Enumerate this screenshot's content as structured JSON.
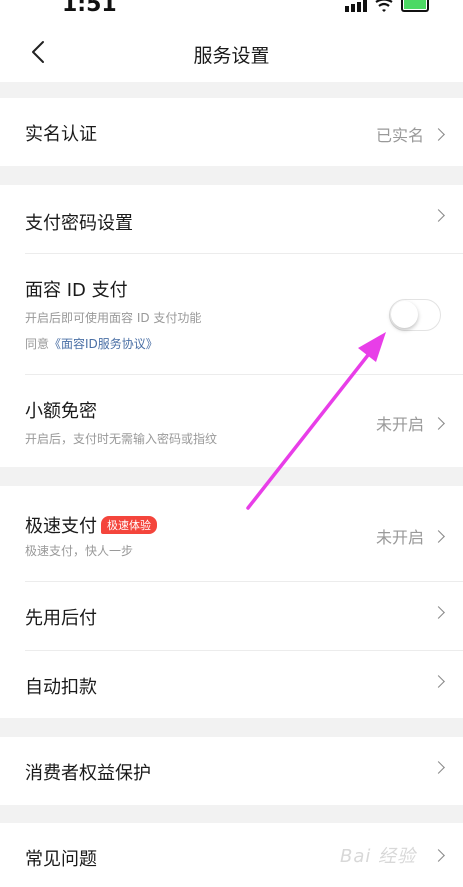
{
  "status_bar": {
    "time": "1:51"
  },
  "nav": {
    "title": "服务设置"
  },
  "rows": {
    "real_name": {
      "title": "实名认证",
      "value": "已实名"
    },
    "pay_password": {
      "title": "支付密码设置"
    },
    "face_id": {
      "title": "面容 ID 支付",
      "subtitle": "开启后即可使用面容 ID 支付功能",
      "agree_prefix": "同意",
      "agreement_link": "《面容ID服务协议》",
      "enabled": false
    },
    "small_free": {
      "title": "小额免密",
      "subtitle": "开启后，支付时无需输入密码或指纹",
      "value": "未开启"
    },
    "fast_pay": {
      "title": "极速支付",
      "badge": "极速体验",
      "subtitle": "极速支付，快人一步",
      "value": "未开启"
    },
    "pay_later": {
      "title": "先用后付"
    },
    "auto_debit": {
      "title": "自动扣款"
    },
    "consumer_rights": {
      "title": "消费者权益保护"
    },
    "faq": {
      "title": "常见问题"
    }
  },
  "watermark": {
    "text": "Bai 经验"
  },
  "colors": {
    "accent_arrow": "#e83ee8",
    "badge_bg": "#f4453c",
    "link": "#4a6fa5"
  }
}
